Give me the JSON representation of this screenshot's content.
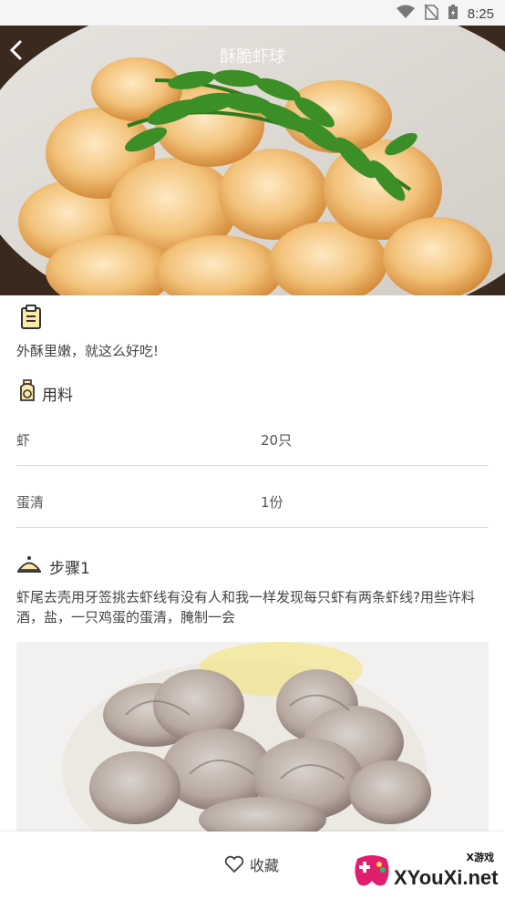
{
  "status_bar": {
    "time": "8:25"
  },
  "header": {
    "title": "酥脆虾球"
  },
  "intro": {
    "text": "外酥里嫩，就这么好吃!"
  },
  "ingredients": {
    "title": "用料",
    "items": [
      {
        "name": "虾",
        "qty": "20只"
      },
      {
        "name": "蛋清",
        "qty": "1份"
      }
    ]
  },
  "steps": [
    {
      "title": "步骤1",
      "text": "虾尾去壳用牙签挑去虾线有没有人和我一样发现每只虾有两条虾线?用些许料酒，盐，一只鸡蛋的蛋清，腌制一会"
    }
  ],
  "bottom_bar": {
    "favorite_label": "收藏"
  },
  "watermark": {
    "small": "X游戏",
    "big": "XYouXi.net"
  },
  "colors": {
    "accent_icon": "#c9a032",
    "divider": "#d9d9d9"
  }
}
